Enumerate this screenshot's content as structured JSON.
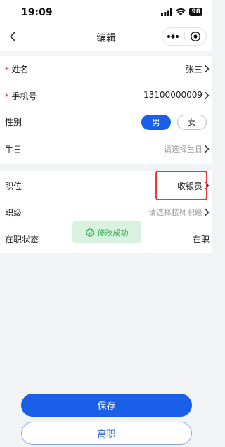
{
  "status_bar": {
    "time": "19:09",
    "battery": "98",
    "signal_icon": "signal-icon",
    "wifi_icon": "wifi-icon"
  },
  "nav": {
    "title": "编辑",
    "back_icon": "chevron-left-icon",
    "more_icon": "more-dots-icon",
    "close_icon": "target-circle-icon"
  },
  "form": {
    "name": {
      "label": "姓名",
      "value": "张三",
      "required": true
    },
    "phone": {
      "label": "手机号",
      "value": "13100000009",
      "required": true
    },
    "gender": {
      "label": "性别",
      "options": [
        "男",
        "女"
      ],
      "selected": "男"
    },
    "birthday": {
      "label": "生日",
      "placeholder": "请选择生日"
    },
    "position": {
      "label": "职位",
      "value": "收银员"
    },
    "level": {
      "label": "职级",
      "placeholder": "请选择技师职级"
    },
    "employment_status": {
      "label": "在职状态",
      "value": "在职"
    }
  },
  "toast": {
    "text": "修改成功",
    "icon": "check-circle-icon"
  },
  "actions": {
    "save_label": "保存",
    "resign_label": "离职"
  },
  "colors": {
    "primary": "#1b5fe8",
    "required": "#e0303a",
    "highlight": "#e8383d",
    "toast_bg": "#d8f2df",
    "toast_text": "#2fa84f"
  }
}
